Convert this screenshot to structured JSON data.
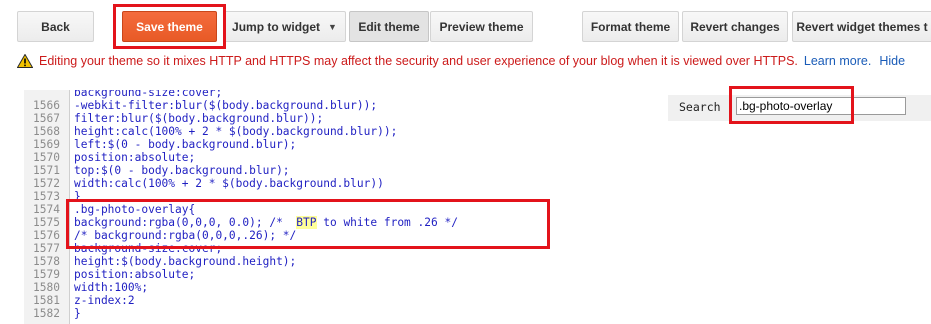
{
  "toolbar": {
    "back": "Back",
    "save_theme": "Save theme",
    "jump_to_widget": "Jump to widget",
    "edit_theme": "Edit theme",
    "preview_theme": "Preview theme",
    "format_theme": "Format theme",
    "revert_changes": "Revert changes",
    "revert_widget_themes": "Revert widget themes t"
  },
  "warning": {
    "message": "Editing your theme so it mixes HTTP and HTTPS may affect the security and user experience of your blog when it is viewed over HTTPS.",
    "learn_more": "Learn more.",
    "hide": "Hide"
  },
  "search": {
    "label": "Search",
    "value": ".bg-photo-overlay"
  },
  "code_lines": [
    {
      "n": "",
      "text": "background-size:cover;"
    },
    {
      "n": "1566",
      "text": "-webkit-filter:blur($(body.background.blur));"
    },
    {
      "n": "1567",
      "text": "filter:blur($(body.background.blur));"
    },
    {
      "n": "1568",
      "text": "height:calc(100% + 2 * $(body.background.blur));"
    },
    {
      "n": "1569",
      "text": "left:$(0 - body.background.blur);"
    },
    {
      "n": "1570",
      "text": "position:absolute;"
    },
    {
      "n": "1571",
      "text": "top:$(0 - body.background.blur);"
    },
    {
      "n": "1572",
      "text": "width:calc(100% + 2 * $(body.background.blur))"
    },
    {
      "n": "1573",
      "text": "}"
    },
    {
      "n": "1574",
      "text": ".bg-photo-overlay{"
    },
    {
      "n": "1575",
      "pre": "background:rgba(0,0,0, 0.0); /*  ",
      "mark": "BTP",
      "post": " to white from .26 */"
    },
    {
      "n": "1576",
      "text": "/* background:rgba(0,0,0,.26); */"
    },
    {
      "n": "1577",
      "text": "background-size:cover;"
    },
    {
      "n": "1578",
      "text": "height:$(body.background.height);"
    },
    {
      "n": "1579",
      "text": "position:absolute;"
    },
    {
      "n": "1580",
      "text": "width:100%;"
    },
    {
      "n": "1581",
      "text": "z-index:2"
    },
    {
      "n": "1582",
      "text": "}"
    }
  ],
  "colors": {
    "primary_button": "#f0622f",
    "annotation_red": "#e3131b",
    "warning_text": "#cc1b1b",
    "link": "#1a5cb8",
    "code_text": "#1f1fc2",
    "search_highlight": "#ffff99"
  }
}
